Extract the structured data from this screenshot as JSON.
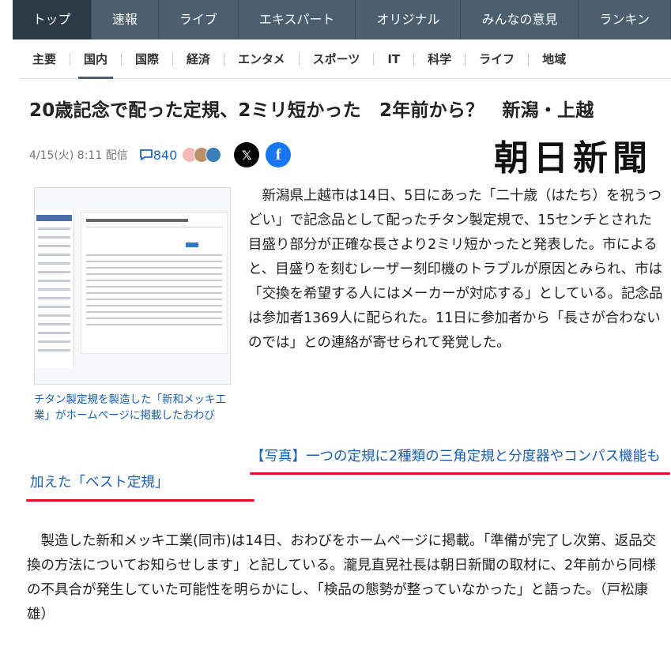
{
  "top_nav": {
    "items": [
      "トップ",
      "速報",
      "ライブ",
      "エキスパート",
      "オリジナル",
      "みんなの意見",
      "ランキン"
    ]
  },
  "sub_nav": {
    "items": [
      "主要",
      "国内",
      "国際",
      "経済",
      "エンタメ",
      "スポーツ",
      "IT",
      "科学",
      "ライフ",
      "地域"
    ]
  },
  "article": {
    "title": "20歳記念で配った定規、2ミリ短かった　2年前から？　新潟・上越",
    "date": "4/15(火) 8:11 配信",
    "comment_count": "840",
    "publisher_logo": "朝日新聞",
    "figure_caption": "チタン製定規を製造した「新和メッキ工業」がホームページに掲載したおわび",
    "paragraph1": "新潟県上越市は14日、5日にあった「二十歳（はたち）を祝うつどい」で記念品として配ったチタン製定規で、15センチとされた目盛り部分が正確な長さより2ミリ短かったと発表した。市によると、目盛りを刻むレーザー刻印機のトラブルが原因とみられ、市は「交換を希望する人にはメーカーが対応する」としている。記念品は参加者1369人に配られた。11日に参加者から「長さが合わないのでは」との連絡が寄せられて発覚した。",
    "photo_link": "【写真】一つの定規に2種類の三角定規と分度器やコンパス機能も加えた「ベスト定規」",
    "paragraph2": "製造した新和メッキ工業(同市)は14日、おわびをホームページに掲載。「準備が完了し次第、返品交換の方法についてお知らせします」と記している。瀧見直晃社長は朝日新聞の取材に、2年前から同様の不具合が発生していた可能性を明らかにし、「検品の態勢が整っていなかった」と語った。（戸松康雄）"
  },
  "icons": {
    "comment": "speech-bubble-icon",
    "x": "x-logo-icon",
    "facebook": "facebook-icon"
  },
  "colors": {
    "nav_bg": "#4b5f6f",
    "nav_active": "#2b3a46",
    "link": "#1a5fb4",
    "underline": "#e0122a"
  }
}
